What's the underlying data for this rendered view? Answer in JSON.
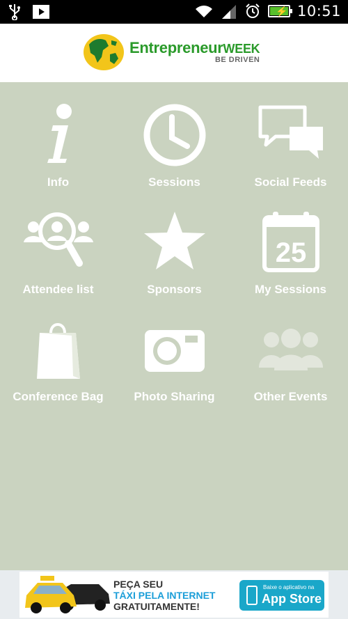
{
  "status_bar": {
    "time": "10:51"
  },
  "header": {
    "logo_brand": "Entrepreneur",
    "logo_week": "WEEK",
    "logo_tagline": "BE DRIVEN"
  },
  "menu": {
    "items": [
      {
        "label": "Info",
        "icon": "info-icon"
      },
      {
        "label": "Sessions",
        "icon": "clock-icon"
      },
      {
        "label": "Social Feeds",
        "icon": "chat-bubbles-icon"
      },
      {
        "label": "Attendee list",
        "icon": "people-search-icon"
      },
      {
        "label": "Sponsors",
        "icon": "star-icon"
      },
      {
        "label": "My Sessions",
        "icon": "calendar-icon",
        "calendar_day": "25"
      },
      {
        "label": "Conference Bag",
        "icon": "shopping-bag-icon"
      },
      {
        "label": "Photo Sharing",
        "icon": "camera-icon"
      },
      {
        "label": "Other Events",
        "icon": "group-icon"
      }
    ]
  },
  "ad": {
    "line1": "PEÇA SEU",
    "line2": "TÁXI PELA INTERNET",
    "line3": "GRATUITAMENTE!",
    "store_small": "Baixe o aplicativo na",
    "store_big": "App Store"
  },
  "colors": {
    "background": "#cad3c0",
    "brand_green": "#2a9a2a",
    "ad_accent": "#1b9ed8"
  }
}
